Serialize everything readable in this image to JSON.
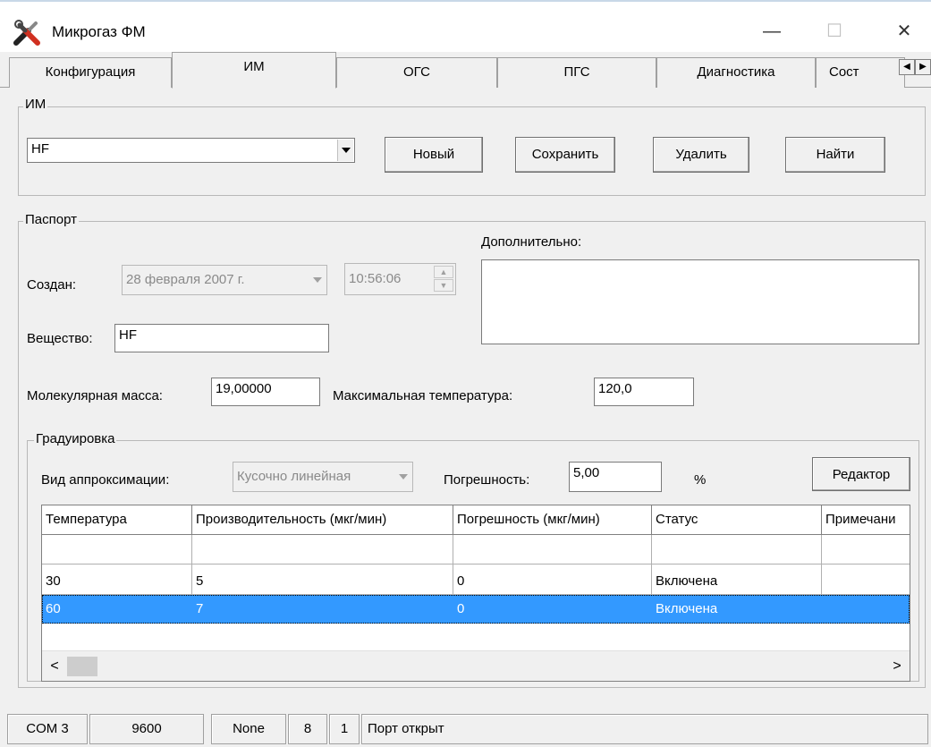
{
  "window": {
    "title": "Микрогаз ФМ",
    "minimize_glyph": "—",
    "maximize_glyph": "☐",
    "close_glyph": "✕",
    "icon": "wrench-screwdriver-icon"
  },
  "tabs": [
    {
      "label": "Конфигурация",
      "active": false
    },
    {
      "label": "ИМ",
      "active": true
    },
    {
      "label": "ОГС",
      "active": false
    },
    {
      "label": "ПГС",
      "active": false
    },
    {
      "label": "Диагностика",
      "active": false
    },
    {
      "label": "Сост",
      "active": false
    }
  ],
  "im_group": {
    "legend": "ИМ",
    "selected": "HF",
    "buttons": {
      "new": "Новый",
      "save": "Сохранить",
      "delete": "Удалить",
      "find": "Найти"
    }
  },
  "passport": {
    "legend": "Паспорт",
    "created_label": "Создан:",
    "created_date": "28 февраля 2007 г.",
    "created_time": "10:56:06",
    "additional_label": "Дополнительно:",
    "additional_value": "",
    "substance_label": "Вещество:",
    "substance_value": "HF",
    "mol_mass_label": "Молекулярная масса:",
    "mol_mass_value": "19,00000",
    "max_temp_label": "Максимальная температура:",
    "max_temp_value": "120,0"
  },
  "calibration": {
    "legend": "Градуировка",
    "approx_label": "Вид аппроксимации:",
    "approx_value": "Кусочно линейная",
    "error_label": "Погрешность:",
    "error_value": "5,00",
    "error_unit": "%",
    "editor_button": "Редактор",
    "columns": [
      "Температура",
      "Производительность (мкг/мин)",
      "Погрешность (мкг/мин)",
      "Статус",
      "Примечани"
    ],
    "rows": [
      [
        "",
        "",
        "",
        "",
        ""
      ],
      [
        "30",
        "5",
        "0",
        "Включена",
        ""
      ],
      [
        "60",
        "7",
        "0",
        "Включена",
        ""
      ]
    ],
    "selected_row": 2,
    "scroll_left_glyph": "<",
    "scroll_right_glyph": ">"
  },
  "status_bar": {
    "port": "COM 3",
    "baud": "9600",
    "parity": "None",
    "data_bits": "8",
    "stop_bits": "1",
    "state": "Порт открыт"
  },
  "colors": {
    "selection": "#3399ff",
    "window_bg": "#f0f0f0"
  }
}
